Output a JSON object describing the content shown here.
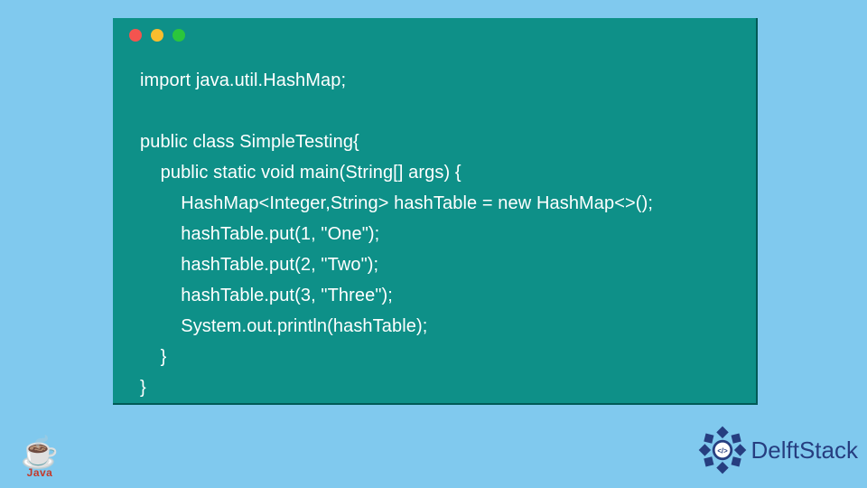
{
  "code": {
    "lines": [
      "import java.util.HashMap;",
      "",
      "public class SimpleTesting{",
      "    public static void main(String[] args) {",
      "        HashMap<Integer,String> hashTable = new HashMap<>();",
      "        hashTable.put(1, \"One\");",
      "        hashTable.put(2, \"Two\");",
      "        hashTable.put(3, \"Three\");",
      "        System.out.println(hashTable);",
      "    }",
      "}"
    ]
  },
  "traffic_lights": {
    "red": "#f4544f",
    "yellow": "#f9bd2e",
    "green": "#2bc63c"
  },
  "java_logo": {
    "label": "Java"
  },
  "brand": {
    "name": "DelftStack",
    "tag_symbol": "</>"
  },
  "colors": {
    "page_bg": "#80c9ee",
    "panel_bg": "#0e9088",
    "code_text": "#ffffff",
    "brand_blue": "#263e80",
    "java_red": "#c33a2b"
  }
}
